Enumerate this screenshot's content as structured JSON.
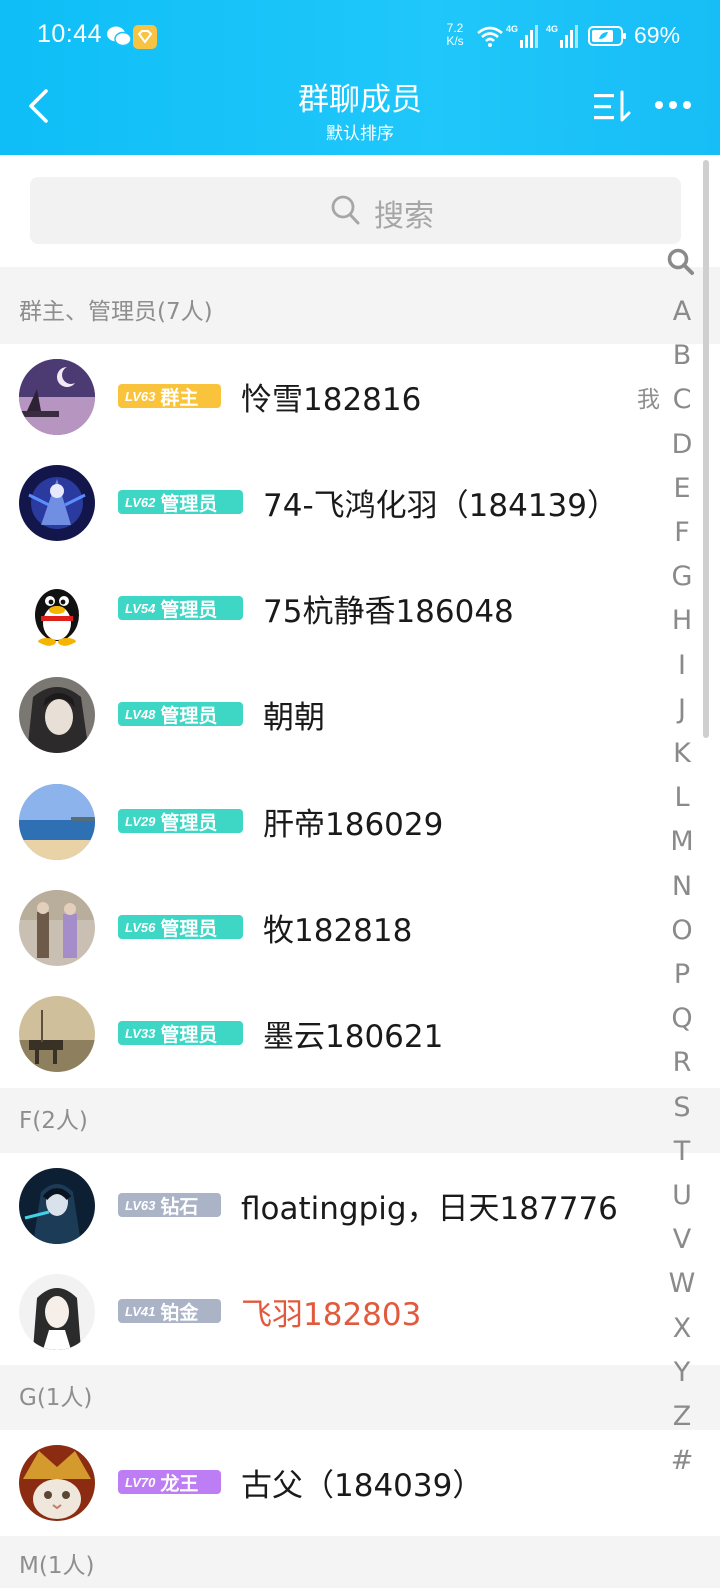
{
  "status": {
    "time": "10:44",
    "speed_value": "7.2",
    "speed_unit": "K/s",
    "network1": "4G",
    "network2": "4G",
    "battery": "69%"
  },
  "header": {
    "title": "群聊成员",
    "subtitle": "默认排序"
  },
  "search": {
    "placeholder": "搜索"
  },
  "sections": [
    {
      "label": "群主、管理员(7人)"
    },
    {
      "label": "F(2人)"
    },
    {
      "label": "G(1人)"
    },
    {
      "label": "M(1人)"
    }
  ],
  "members": [
    {
      "level": "LV63",
      "role": "群主",
      "name": "怜雪182816",
      "me": "我",
      "badge_color": "#f9c43c"
    },
    {
      "level": "LV62",
      "role": "管理员",
      "name": "74-飞鸿化羽（184139）",
      "badge_color": "#3ed6c4"
    },
    {
      "level": "LV54",
      "role": "管理员",
      "name": "75杭静香186048",
      "badge_color": "#3ed6c4"
    },
    {
      "level": "LV48",
      "role": "管理员",
      "name": "朝朝",
      "badge_color": "#3ed6c4"
    },
    {
      "level": "LV29",
      "role": "管理员",
      "name": "肝帝186029",
      "badge_color": "#3ed6c4"
    },
    {
      "level": "LV56",
      "role": "管理员",
      "name": "牧182818",
      "badge_color": "#3ed6c4"
    },
    {
      "level": "LV33",
      "role": "管理员",
      "name": "墨云180621",
      "badge_color": "#3ed6c4"
    },
    {
      "level": "LV63",
      "role": "钻石",
      "name": "floatingpig，日天187776",
      "badge_color": "#abb3c7"
    },
    {
      "level": "LV41",
      "role": "铂金",
      "name": "飞羽182803",
      "name_color": "#e25a3d",
      "badge_color": "#abb3c7"
    },
    {
      "level": "LV70",
      "role": "龙王",
      "name": "古父（184039）",
      "badge_color": "#bd7ef5"
    }
  ],
  "index_letters": [
    "A",
    "B",
    "C",
    "D",
    "E",
    "F",
    "G",
    "H",
    "I",
    "J",
    "K",
    "L",
    "M",
    "N",
    "O",
    "P",
    "Q",
    "R",
    "S",
    "T",
    "U",
    "V",
    "W",
    "X",
    "Y",
    "Z",
    "#"
  ],
  "colors": {
    "header_accent": "#17bdf6",
    "owner_badge": "#f9c43c",
    "admin_badge": "#3ed6c4",
    "tier_badge": "#abb3c7",
    "dragon_badge": "#bd7ef5",
    "highlight_name": "#e25a3d"
  }
}
